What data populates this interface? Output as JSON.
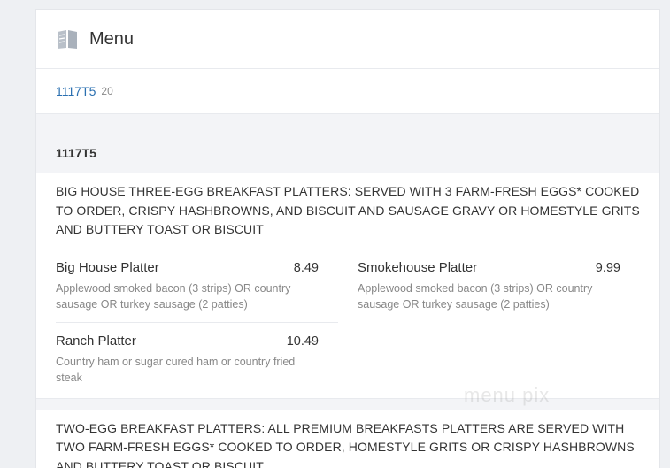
{
  "header": {
    "title": "Menu",
    "icon": "book-icon"
  },
  "tabs": {
    "link": "1117T5",
    "count": "20"
  },
  "section": {
    "title": "1117T5",
    "description": "BIG HOUSE THREE-EGG BREAKFAST PLATTERS: SERVED WITH 3 FARM-FRESH EGGS* COOKED TO ORDER, CRISPY HASHBROWNS, AND BISCUIT AND SAUSAGE GRAVY OR HOMESTYLE GRITS AND BUTTERY TOAST OR BISCUIT",
    "items": [
      {
        "name": "Big House Platter",
        "price": "8.49",
        "desc": "Applewood smoked bacon (3 strips) OR country sausage OR turkey sausage (2 patties)"
      },
      {
        "name": "Smokehouse Platter",
        "price": "9.99",
        "desc": "Applewood smoked bacon (3 strips) OR country sausage OR turkey sausage (2 patties)"
      },
      {
        "name": "Ranch Platter",
        "price": "10.49",
        "desc": "Country ham or sugar cured ham or country fried steak"
      }
    ]
  },
  "section2": {
    "description": "TWO-EGG BREAKFAST PLATTERS: ALL PREMIUM BREAKFASTS PLATTERS ARE SERVED WITH TWO FARM-FRESH EGGS* COOKED TO ORDER, HOMESTYLE GRITS OR CRISPY HASHBROWNS AND BUTTERY TOAST OR BISCUIT"
  },
  "watermark": "menu pix"
}
